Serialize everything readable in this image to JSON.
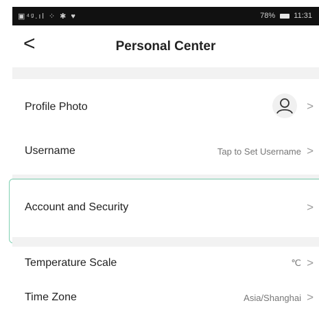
{
  "status_bar": {
    "left_icons": "▣⁴ᵍ.ıl ⁘ ✱ ♥",
    "battery": "78%",
    "time": "11:31"
  },
  "header": {
    "back_icon": "chevron-left",
    "title": "Personal Center"
  },
  "rows": {
    "profile_photo": {
      "label": "Profile Photo"
    },
    "username": {
      "label": "Username",
      "value": "Tap to Set Username"
    },
    "account_security": {
      "label": "Account and Security"
    },
    "temperature_scale": {
      "label": "Temperature Scale",
      "value": "℃"
    },
    "time_zone": {
      "label": "Time Zone",
      "value": "Asia/Shanghai"
    }
  },
  "chevron_glyph": ">",
  "colors": {
    "highlight_border": "#7fd0b2",
    "section_gap": "#f2f2f2",
    "text_primary": "#222222",
    "text_secondary": "#777777"
  }
}
